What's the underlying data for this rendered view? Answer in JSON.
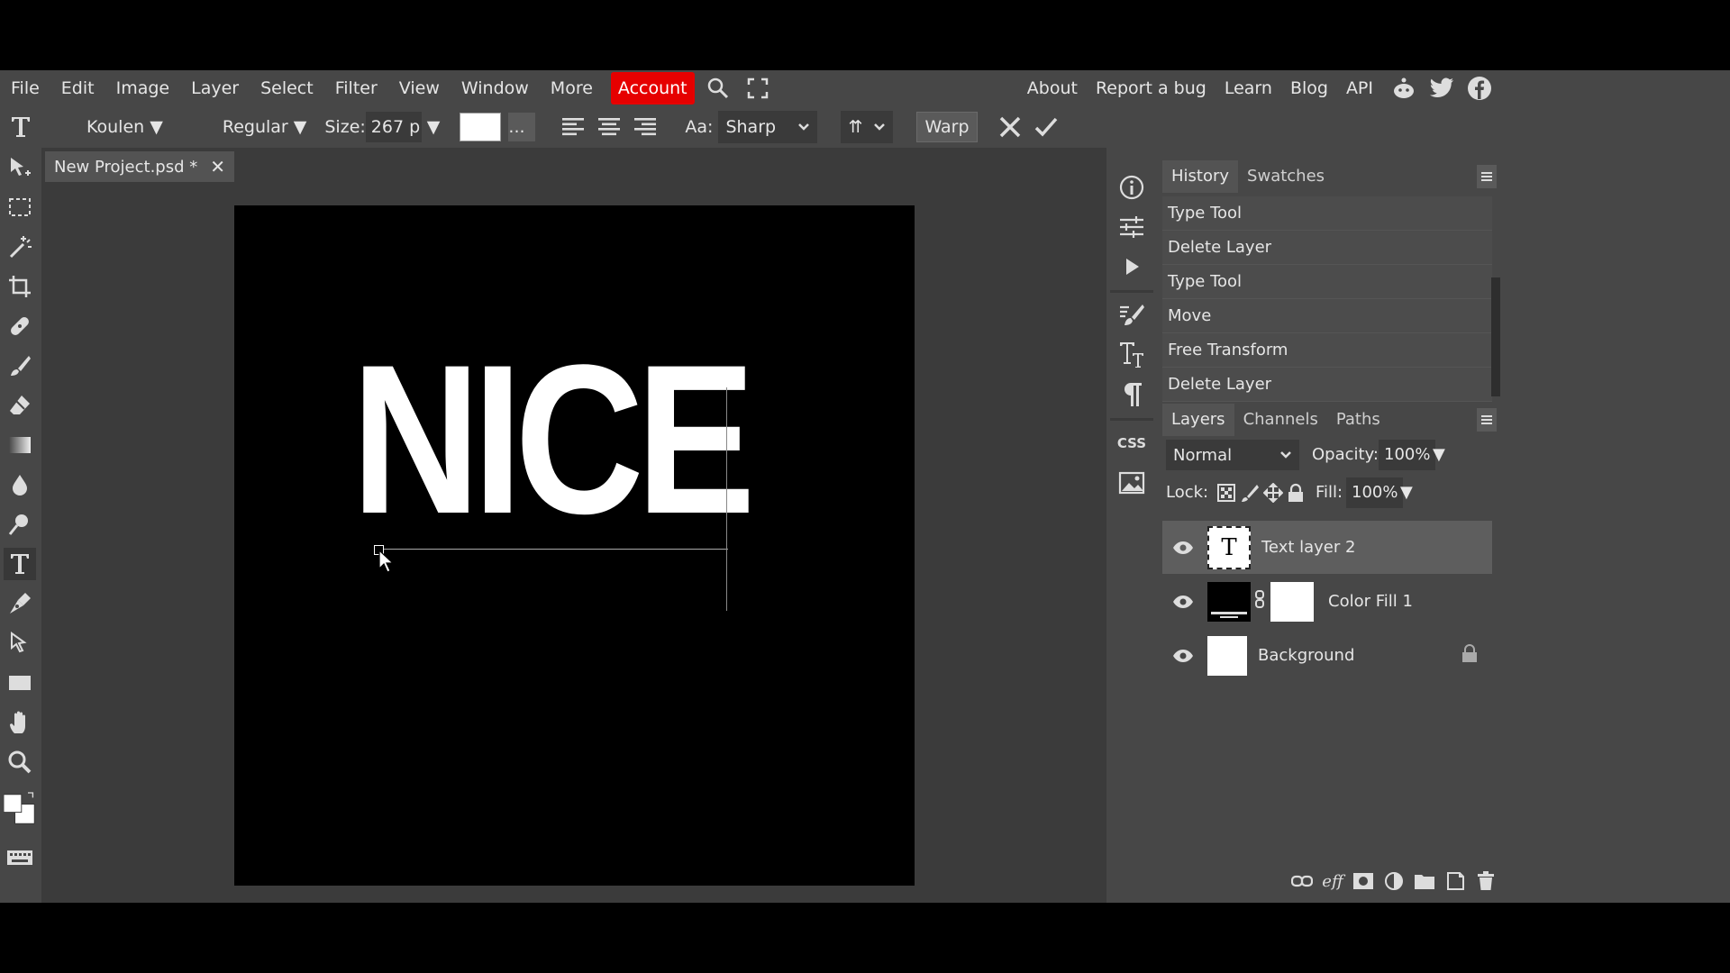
{
  "menu": {
    "items": [
      "File",
      "Edit",
      "Image",
      "Layer",
      "Select",
      "Filter",
      "View",
      "Window",
      "More"
    ],
    "account": "Account",
    "right": [
      "About",
      "Report a bug",
      "Learn",
      "Blog",
      "API"
    ],
    "account_color": "#e60000"
  },
  "options": {
    "font": "Koulen ▼",
    "style": "Regular ▼",
    "size_label": "Size:",
    "size_value": "267 p",
    "size_arrow": "▼",
    "dots": "...",
    "aa_label": "Aa:",
    "aa_value": "Sharp",
    "tt": "⇈",
    "warp": "Warp"
  },
  "document": {
    "tab_title": "New Project.psd *",
    "close": "✕",
    "text": "NICE"
  },
  "history": {
    "tabs": [
      "History",
      "Swatches"
    ],
    "items": [
      "Type Tool",
      "Delete Layer",
      "Type Tool",
      "Move",
      "Free Transform",
      "Delete Layer"
    ]
  },
  "layers": {
    "tabs": [
      "Layers",
      "Channels",
      "Paths"
    ],
    "blend_mode": "Normal",
    "opacity_label": "Opacity:",
    "opacity_value": "100%",
    "lock_label": "Lock:",
    "fill_label": "Fill:",
    "fill_value": "100%",
    "items": [
      {
        "name": "Text layer 2",
        "thumb": "T"
      },
      {
        "name": "Color Fill 1"
      },
      {
        "name": "Background"
      }
    ]
  },
  "strip": {
    "css_label": "CSS"
  }
}
